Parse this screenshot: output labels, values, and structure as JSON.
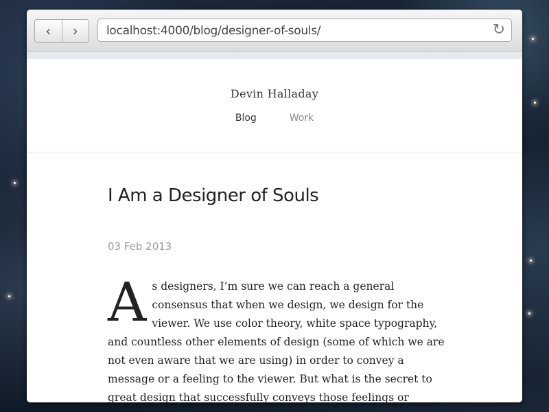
{
  "browser": {
    "back_glyph": "‹",
    "forward_glyph": "›",
    "url": "localhost:4000/blog/designer-of-souls/",
    "reload_glyph": "↻"
  },
  "site": {
    "title": "Devin Halladay",
    "nav": [
      "Blog",
      "Work"
    ]
  },
  "post": {
    "title": "I Am a Designer of Souls",
    "date": "03 Feb 2013",
    "dropcap": "A",
    "body": "s designers, I’m sure we can reach a general consensus that when we design, we design for the viewer. We use color theory, white space typography, and countless other elements of design (some of which we are not even aware that we are using) in order to convey a message or a feeling to the viewer. But what is the secret to great design that successfully conveys those feelings or messages to the user?"
  },
  "colors": {
    "background_space": "#13202f",
    "nav_active": "#333333",
    "nav_inactive": "#888888",
    "date": "#999999"
  }
}
